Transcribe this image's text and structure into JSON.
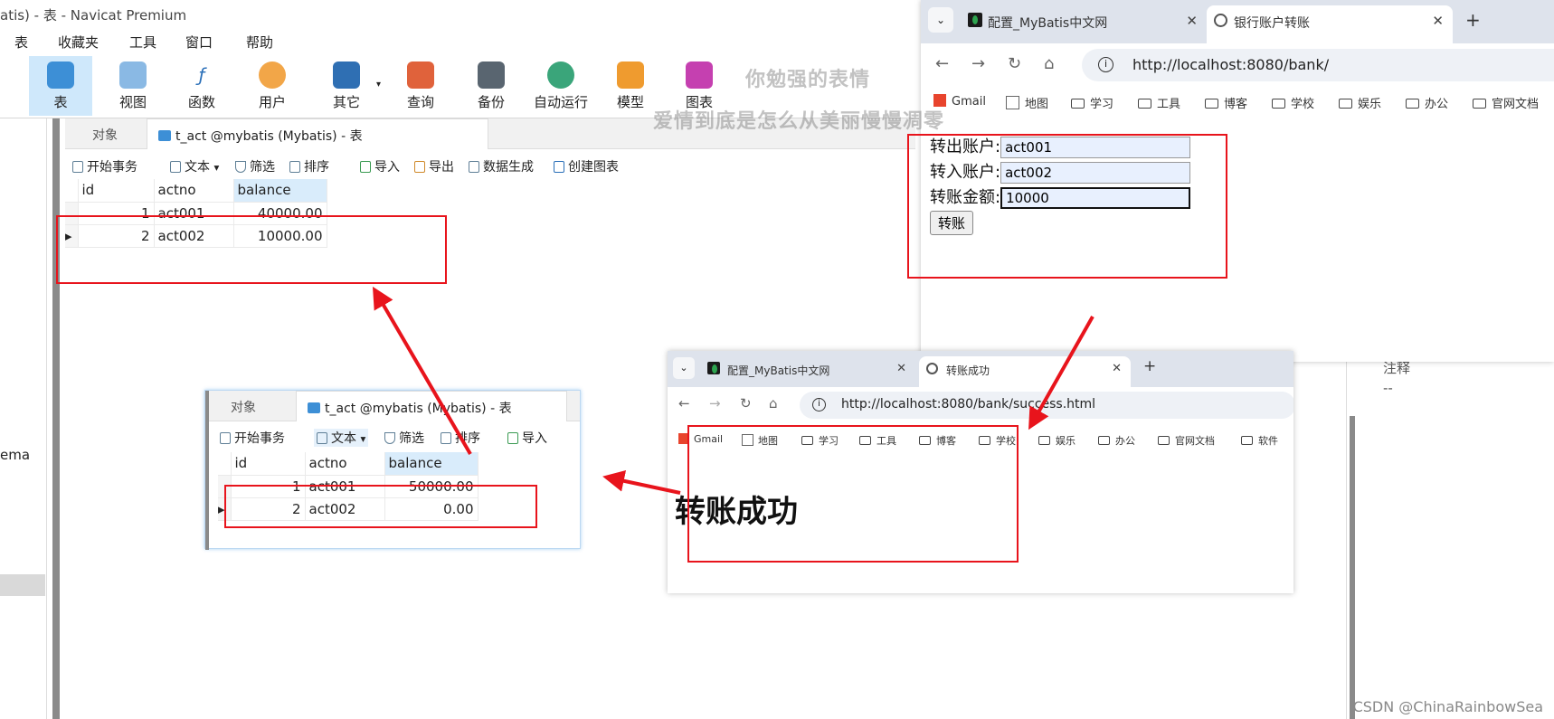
{
  "navicat": {
    "title": "atis) - 表 - Navicat Premium",
    "menu": [
      "表",
      "收藏夹",
      "工具",
      "窗口",
      "帮助"
    ],
    "toolbar": [
      "表",
      "视图",
      "函数",
      "用户",
      "其它",
      "查询",
      "备份",
      "自动运行",
      "模型",
      "图表"
    ],
    "left_label": "ema",
    "tabs": {
      "objects": "对象",
      "table": "t_act @mybatis (Mybatis) - 表"
    },
    "subtoolbar": [
      "开始事务",
      "文本",
      "筛选",
      "排序",
      "导入",
      "导出",
      "数据生成",
      "创建图表"
    ],
    "columns": [
      "id",
      "actno",
      "balance"
    ],
    "rows_after": [
      {
        "id": "1",
        "actno": "act001",
        "balance": "40000.00"
      },
      {
        "id": "2",
        "actno": "act002",
        "balance": "10000.00"
      }
    ],
    "popup": {
      "tabs": {
        "objects": "对象",
        "table": "t_act @mybatis (Mybatis) - 表"
      },
      "subtoolbar": [
        "开始事务",
        "文本",
        "筛选",
        "排序",
        "导入"
      ],
      "rows_before": [
        {
          "id": "1",
          "actno": "act001",
          "balance": "50000.00"
        },
        {
          "id": "2",
          "actno": "act002",
          "balance": "0.00"
        }
      ]
    },
    "right_panel": {
      "label": "注释",
      "value": "--"
    }
  },
  "browser1": {
    "tabs": [
      {
        "label": "配置_MyBatis中文网"
      },
      {
        "label": "银行账户转账"
      }
    ],
    "url": "http://localhost:8080/bank/",
    "bookmarks": [
      "Gmail",
      "地图",
      "学习",
      "工具",
      "博客",
      "学校",
      "娱乐",
      "办公",
      "官网文档"
    ],
    "form": {
      "from_label": "转出账户:",
      "from_value": "act001",
      "to_label": "转入账户:",
      "to_value": "act002",
      "amount_label": "转账金额:",
      "amount_value": "10000",
      "submit": "转账"
    }
  },
  "browser2": {
    "tabs": [
      {
        "label": "配置_MyBatis中文网"
      },
      {
        "label": "转账成功"
      }
    ],
    "url": "http://localhost:8080/bank/success.html",
    "bookmarks": [
      "Gmail",
      "地图",
      "学习",
      "工具",
      "博客",
      "学校",
      "娱乐",
      "办公",
      "官网文档",
      "软件"
    ],
    "message": "转账成功"
  },
  "watermark": {
    "line1": "你勉强的表情",
    "line2": "爱情到底是怎么从美丽慢慢凋零"
  },
  "credit": "CSDN @ChinaRainbowSea",
  "colors": {
    "annotation_red": "#e8141c",
    "selection_blue": "#cfe8fb"
  }
}
